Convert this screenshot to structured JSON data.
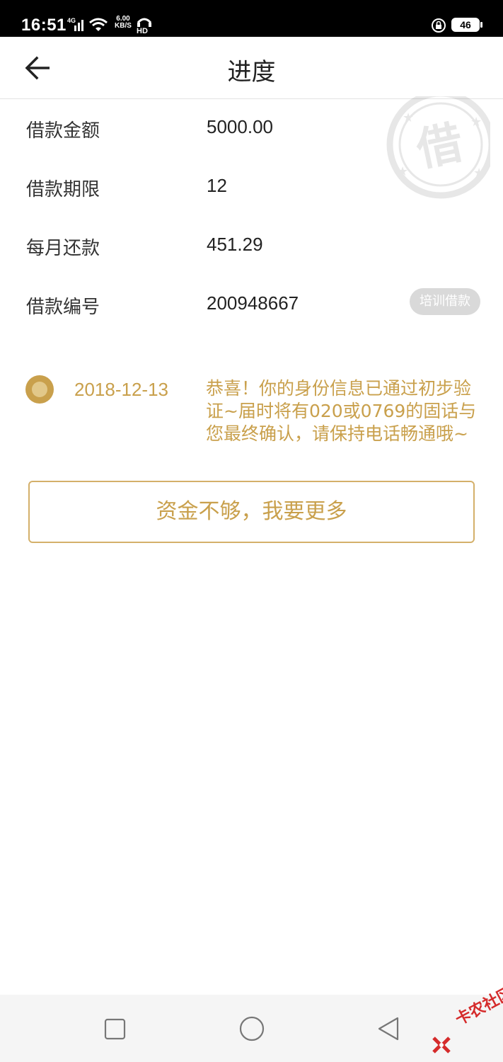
{
  "status_bar": {
    "time": "16:51",
    "network_type": "4G",
    "speed_value": "6.00",
    "speed_unit": "KB/S",
    "hd_label": "HD",
    "battery": "46"
  },
  "header": {
    "title": "进度",
    "back_icon": "arrow-left-icon"
  },
  "loan_info": {
    "rows": [
      {
        "label": "借款金额",
        "value": "5000.00"
      },
      {
        "label": "借款期限",
        "value": "12"
      },
      {
        "label": "每月还款",
        "value": "451.29"
      },
      {
        "label": "借款编号",
        "value": "200948667"
      }
    ],
    "tag": "培训借款",
    "stamp_char": "借"
  },
  "timeline": {
    "items": [
      {
        "date": "2018-12-13",
        "message": "恭喜！你的身份信息已通过初步验证~届时将有020或0769的固话与您最终确认，请保持电话畅通哦~"
      }
    ]
  },
  "actions": {
    "more_funds_label": "资金不够，我要更多"
  },
  "watermark": {
    "text": "卡农社区"
  },
  "colors": {
    "accent": "#c9a04c",
    "accent_border": "#d4b06a",
    "tag_bg": "#d9d9d9",
    "status_bar_bg": "#000000",
    "nav_bar_bg": "#f5f5f5"
  }
}
